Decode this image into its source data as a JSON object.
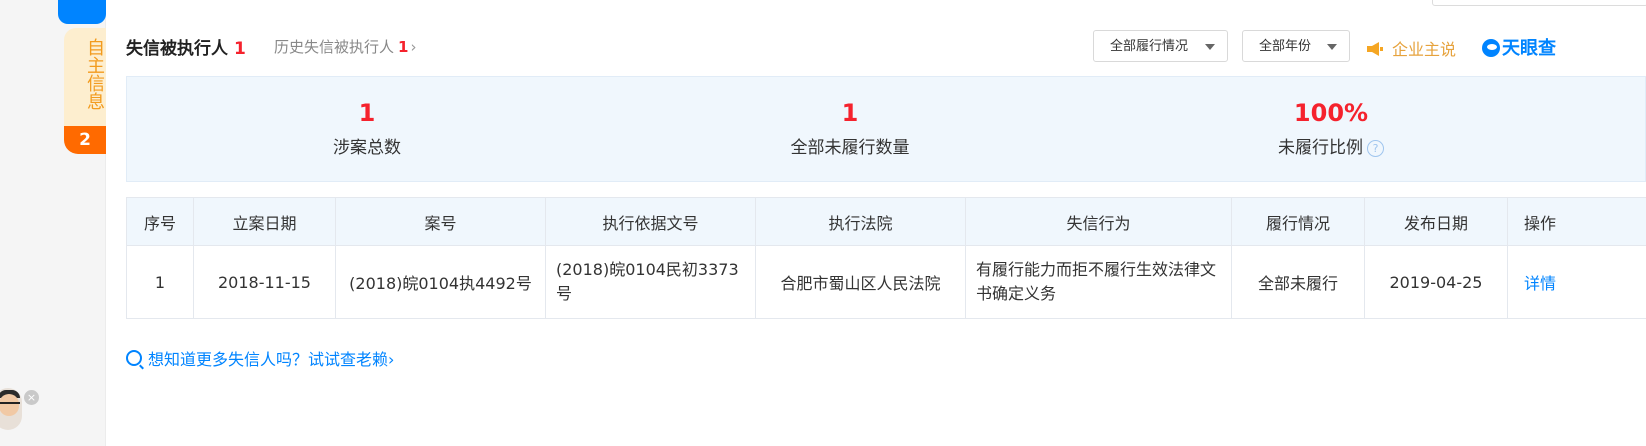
{
  "sidebar": {
    "self_info_label": "自主信息",
    "self_info_count": "2"
  },
  "header": {
    "title": "失信被执行人",
    "title_count": "1",
    "history_label": "历史失信被执行人",
    "history_count": "1",
    "history_chevron": "›",
    "filter_status": "全部履行情况",
    "filter_year": "全部年份",
    "owner_label": "企业主说",
    "brand": "天眼查"
  },
  "stats": [
    {
      "value": "1",
      "label": "涉案总数"
    },
    {
      "value": "1",
      "label": "全部未履行数量"
    },
    {
      "value": "100%",
      "label": "未履行比例",
      "help": "?"
    }
  ],
  "table": {
    "columns": [
      "序号",
      "立案日期",
      "案号",
      "执行依据文号",
      "执行法院",
      "失信行为",
      "履行情况",
      "发布日期",
      "操作"
    ],
    "rows": [
      [
        "1",
        "2018-11-15",
        "(2018)皖0104执4492号",
        "(2018)皖0104民初3373号",
        "合肥市蜀山区人民法院",
        "有履行能力而拒不履行生效法律文书确定义务",
        "全部未履行",
        "2019-04-25",
        "详情"
      ]
    ]
  },
  "footer": {
    "tip": "想知道更多失信人吗？试试查老赖",
    "tip_chevron": "›"
  },
  "colors": {
    "accent": "#0084ff",
    "red": "#f5222d",
    "orange": "#ff6a00",
    "gold": "#e6a23c"
  }
}
